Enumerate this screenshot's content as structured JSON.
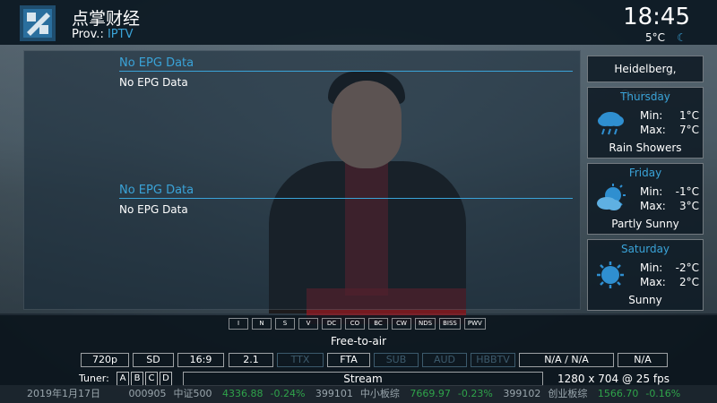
{
  "header": {
    "channel_name": "点掌财经",
    "provider_label": "Prov.:",
    "provider_value": "IPTV",
    "clock": "18:45",
    "temperature": "5°C"
  },
  "epg": [
    {
      "title": "No EPG Data",
      "description": "No EPG Data"
    },
    {
      "title": "No EPG Data",
      "description": "No EPG Data"
    }
  ],
  "weather": {
    "location": "Heidelberg, Germany",
    "days": [
      {
        "name": "Thursday",
        "min_label": "Min:",
        "min": "1°C",
        "max_label": "Max:",
        "max": "7°C",
        "condition": "Rain Showers",
        "icon": "rain-cloud-icon"
      },
      {
        "name": "Friday",
        "min_label": "Min:",
        "min": "-1°C",
        "max_label": "Max:",
        "max": "3°C",
        "condition": "Partly Sunny",
        "icon": "partly-sunny-icon"
      },
      {
        "name": "Saturday",
        "min_label": "Min:",
        "min": "-2°C",
        "max_label": "Max:",
        "max": "2°C",
        "condition": "Sunny",
        "icon": "sun-icon"
      }
    ]
  },
  "ca_systems": [
    "I",
    "N",
    "S",
    "V",
    "DC",
    "CO",
    "BC",
    "CW",
    "NDS",
    "BISS",
    "PWV"
  ],
  "encryption_label": "Free-to-air",
  "info_badges": {
    "resolution": "720p",
    "definition": "SD",
    "aspect": "16:9",
    "audio_channels": "2.1",
    "ttx": "TTX",
    "fta": "FTA",
    "sub": "SUB",
    "aud": "AUD",
    "hbbtv": "HBBTV",
    "na_pair": "N/A /  N/A",
    "na_single": "N/A"
  },
  "tuner": {
    "label": "Tuner:",
    "slots": [
      "A",
      "B",
      "C",
      "D"
    ]
  },
  "stream_label": "Stream",
  "resolution_info": "1280 x 704 @ 25 fps",
  "ticker": {
    "date": "2019年1月17日",
    "items": [
      {
        "code": "000905",
        "name": "中证500",
        "value": "4336.88",
        "change": "-0.24%"
      },
      {
        "code": "399101",
        "name": "中小板综",
        "value": "7669.97",
        "change": "-0.23%"
      },
      {
        "code": "399102",
        "name": "创业板综",
        "value": "1566.70",
        "change": "-0.16%"
      }
    ]
  },
  "colors": {
    "accent": "#3aa3d8",
    "text": "#ffffff",
    "panel": "#0f1c26"
  }
}
